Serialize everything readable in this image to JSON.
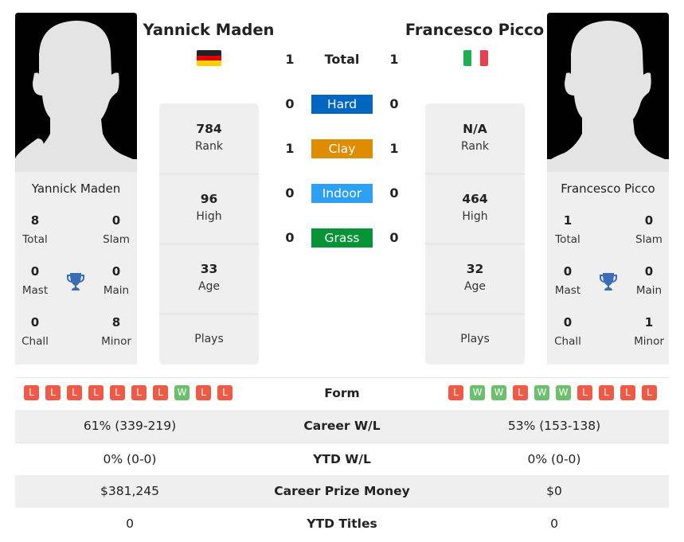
{
  "players": [
    {
      "name": "Yannick Maden",
      "country": "Germany",
      "flag_icon": "germany-flag-icon",
      "titles": {
        "total": {
          "value": "8",
          "label": "Total"
        },
        "slam": {
          "value": "0",
          "label": "Slam"
        },
        "mast": {
          "value": "0",
          "label": "Mast"
        },
        "main": {
          "value": "0",
          "label": "Main"
        },
        "chall": {
          "value": "0",
          "label": "Chall"
        },
        "minor": {
          "value": "8",
          "label": "Minor"
        }
      },
      "stats": {
        "rank": {
          "value": "784",
          "label": "Rank"
        },
        "high": {
          "value": "96",
          "label": "High"
        },
        "age": {
          "value": "33",
          "label": "Age"
        },
        "plays": {
          "label": "Plays"
        }
      },
      "form": [
        "L",
        "L",
        "L",
        "L",
        "L",
        "L",
        "L",
        "W",
        "L",
        "L"
      ]
    },
    {
      "name": "Francesco Picco",
      "country": "Italy",
      "flag_icon": "italy-flag-icon",
      "titles": {
        "total": {
          "value": "1",
          "label": "Total"
        },
        "slam": {
          "value": "0",
          "label": "Slam"
        },
        "mast": {
          "value": "0",
          "label": "Mast"
        },
        "main": {
          "value": "0",
          "label": "Main"
        },
        "chall": {
          "value": "0",
          "label": "Chall"
        },
        "minor": {
          "value": "1",
          "label": "Minor"
        }
      },
      "stats": {
        "rank": {
          "value": "N/A",
          "label": "Rank"
        },
        "high": {
          "value": "464",
          "label": "High"
        },
        "age": {
          "value": "32",
          "label": "Age"
        },
        "plays": {
          "label": "Plays"
        }
      },
      "form": [
        "L",
        "W",
        "W",
        "L",
        "W",
        "W",
        "L",
        "L",
        "L",
        "L"
      ]
    }
  ],
  "h2h": {
    "total": {
      "label": "Total",
      "p1": "1",
      "p2": "1"
    },
    "surfaces": [
      {
        "label": "Hard",
        "p1": "0",
        "p2": "0",
        "color": "#0066c0"
      },
      {
        "label": "Clay",
        "p1": "1",
        "p2": "1",
        "color": "#e08c00"
      },
      {
        "label": "Indoor",
        "p1": "0",
        "p2": "0",
        "color": "#2d9ff5"
      },
      {
        "label": "Grass",
        "p1": "0",
        "p2": "0",
        "color": "#079338"
      }
    ]
  },
  "comparison": {
    "form_label": "Form",
    "rows": [
      {
        "label": "Career W/L",
        "p1": "61% (339-219)",
        "p2": "53% (153-138)"
      },
      {
        "label": "YTD W/L",
        "p1": "0% (0-0)",
        "p2": "0% (0-0)"
      },
      {
        "label": "Career Prize Money",
        "p1": "$381,245",
        "p2": "$0"
      },
      {
        "label": "YTD Titles",
        "p1": "0",
        "p2": "0"
      }
    ]
  },
  "colors": {
    "loss": "#ee5a45",
    "win": "#6cbf6c",
    "trophy": "#3a6cb8",
    "card_bg": "#efefef"
  }
}
